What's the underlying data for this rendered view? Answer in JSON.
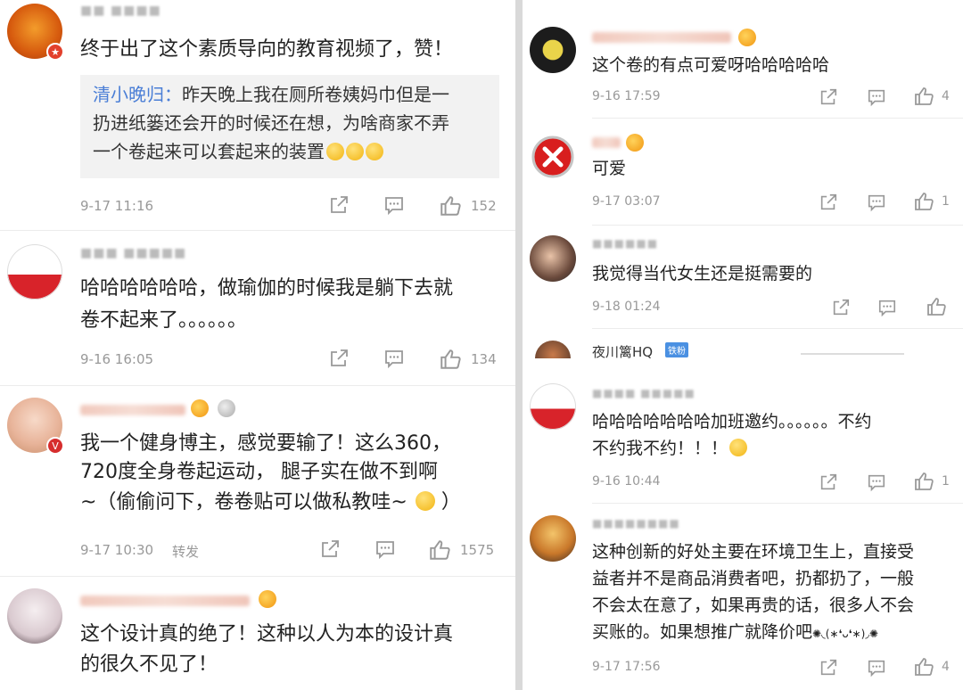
{
  "left": {
    "comments": [
      {
        "text_lines": [
          "终于出了这个素质导向的教育视频了，赞！"
        ],
        "quote": {
          "name": "清小晚归：",
          "lines": [
            "昨天晚上我在厕所卷姨妈巾但是一",
            "扔进纸篓还会开的时候还在想，为啥商家不弄",
            "一个卷起来可以套起来的装置"
          ]
        },
        "time": "9-17 11:16",
        "likes": "152"
      },
      {
        "text_lines": [
          "哈哈哈哈哈哈，做瑜伽的时候我是躺下去就",
          "卷不起来了。。。。。。"
        ],
        "time": "9-16 16:05",
        "likes": "134"
      },
      {
        "text_lines": [
          "我一个健身博主，感觉要输了！这么360，",
          "720度全身卷起运动， 腿子实在做不到啊",
          "~（偷偷问下，卷卷贴可以做私教哇~",
          "）"
        ],
        "time": "9-17 10:30",
        "repost": "转发",
        "likes": "1575"
      },
      {
        "text_lines": [
          "这个设计真的绝了！这种以人为本的设计真",
          "的很久不见了！"
        ]
      }
    ]
  },
  "right": {
    "comments": [
      {
        "text_lines": [
          "这个卷的有点可爱呀哈哈哈哈哈"
        ],
        "time": "9-16 17:59",
        "likes": "4"
      },
      {
        "text_lines": [
          "可爱"
        ],
        "time": "9-17 03:07",
        "likes": "1"
      },
      {
        "text_lines": [
          "我觉得当代女生还是挺需要的"
        ],
        "time": "9-18 01:24",
        "likes": ""
      },
      {
        "name": "夜川篱HQ",
        "tag": "铁粉"
      },
      {
        "text_lines": [
          "哈哈哈哈哈哈哈加班邀约。。。。。。不约",
          "不约我不约！！！"
        ],
        "time": "9-16 10:44",
        "likes": "1"
      },
      {
        "text_lines": [
          "这种创新的好处主要在环境卫生上，直接受",
          "益者并不是商品消费者吧，扔都扔了，一般",
          "不会太在意了，如果再贵的话，很多人不会",
          "买账的。如果想推广就降价吧"
        ],
        "kaomoji": "✺◟(∗❛ᴗ❛∗)◞✺",
        "time": "9-17 17:56",
        "likes": "4"
      }
    ]
  },
  "icons": [
    "share-icon",
    "comment-icon",
    "thumbs-up-icon"
  ]
}
